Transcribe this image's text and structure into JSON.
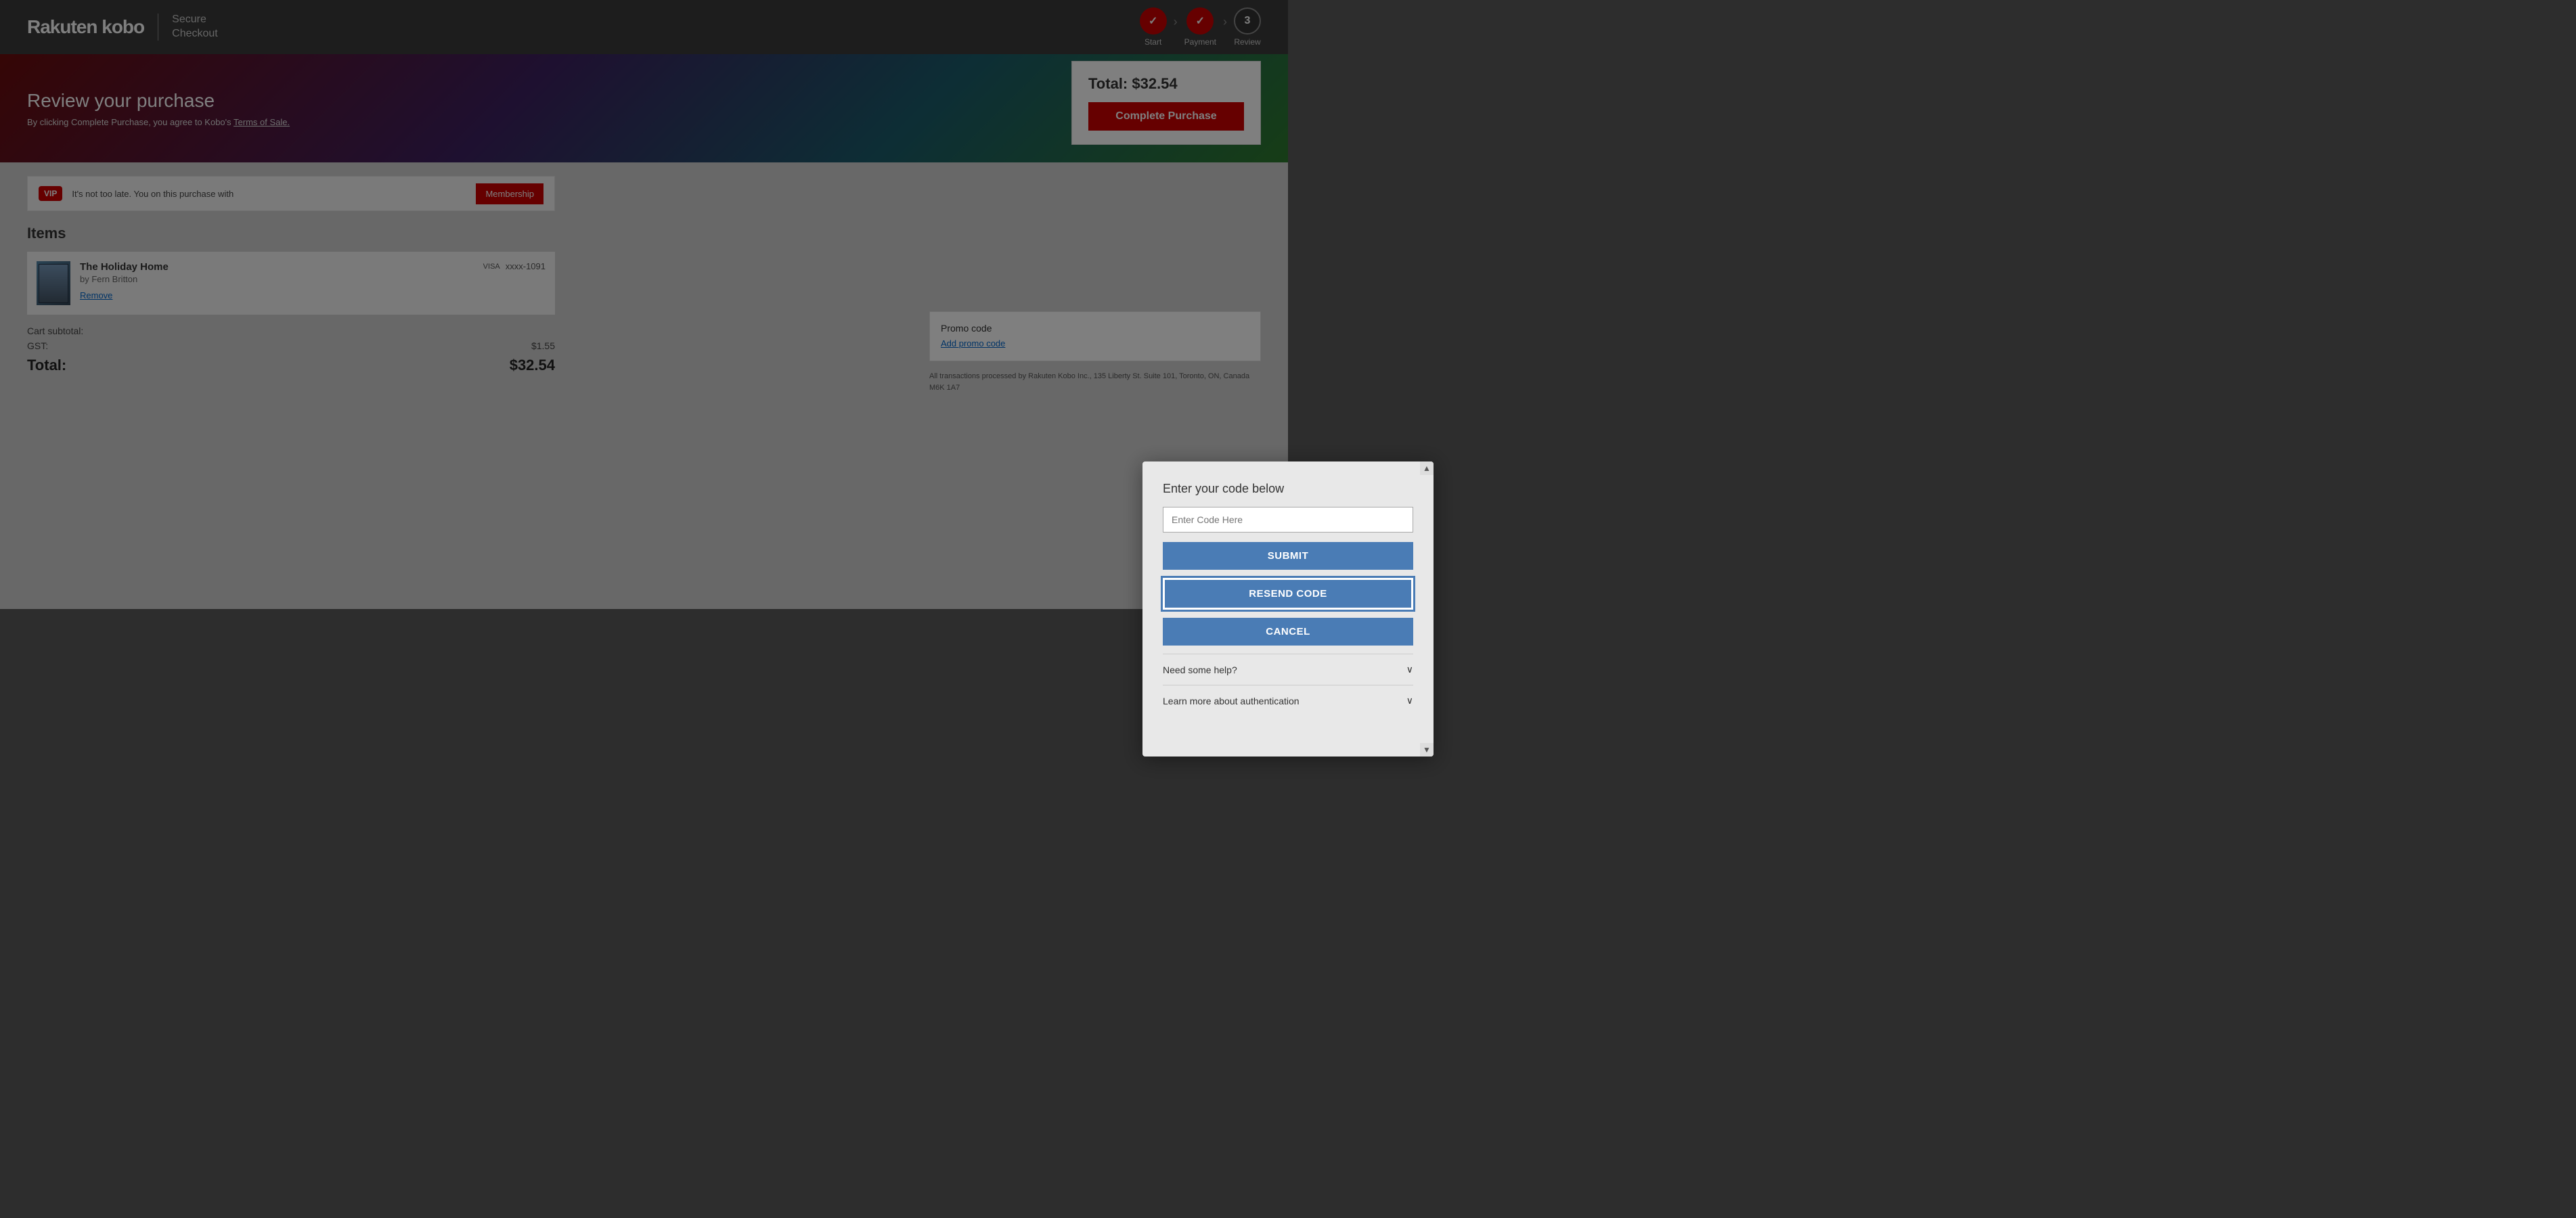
{
  "header": {
    "logo_rakuten": "Rakuten",
    "logo_kobo": "kobo",
    "secure_checkout_line1": "Secure",
    "secure_checkout_line2": "Checkout",
    "steps": [
      {
        "id": "start",
        "label": "Start",
        "state": "done",
        "icon": "✓"
      },
      {
        "id": "payment",
        "label": "Payment",
        "state": "done",
        "icon": "✓"
      },
      {
        "id": "review",
        "label": "Review",
        "state": "current",
        "icon": "3"
      }
    ]
  },
  "banner": {
    "title": "Review your purchase",
    "subtitle": "By clicking Complete Purchase, you agree to Kobo's",
    "tos_link": "Terms of Sale."
  },
  "order_summary": {
    "total_label": "Total: $32.54",
    "complete_purchase_btn": "Complete Purchase"
  },
  "vip": {
    "badge": "VIP",
    "text": "It's not too late. You",
    "text2": "on this purchase with",
    "btn_label": "Membership"
  },
  "items_section": {
    "title": "Items",
    "items": [
      {
        "title": "The Holiday Home",
        "author": "by Fern Britton",
        "remove_label": "Remove",
        "price_suffix": "xxxx-1091"
      }
    ]
  },
  "cart": {
    "subtotal_label": "Cart subtotal:",
    "gst_label": "GST:",
    "gst_value": "$1.55",
    "total_label": "Total:",
    "total_value": "$32.54"
  },
  "promo": {
    "label": "Promo code",
    "add_label": "Add promo code",
    "legal": "All transactions processed by Rakuten Kobo Inc., 135 Liberty St. Suite 101, Toronto, ON, Canada M6K 1A7"
  },
  "modal": {
    "title": "Enter your code below",
    "code_input_placeholder": "Enter Code Here",
    "submit_btn": "SUBMIT",
    "resend_btn": "RESEND CODE",
    "cancel_btn": "CANCEL",
    "accordion": [
      {
        "label": "Need some help?",
        "open": false
      },
      {
        "label": "Learn more about authentication",
        "open": false
      }
    ]
  }
}
